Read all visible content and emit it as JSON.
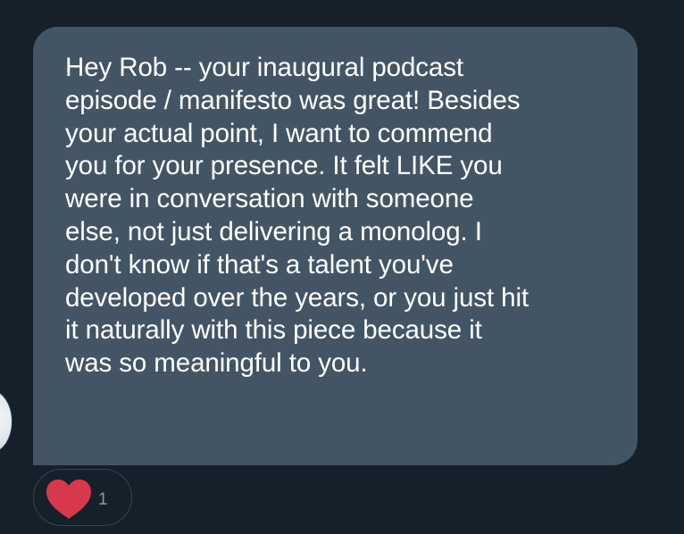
{
  "message": {
    "text": "Hey Rob -- your inaugural podcast\nepisode / manifesto was great! Besides\nyour actual point, I want to commend\nyou for your presence. It felt LIKE you\nwere in conversation with someone\nelse, not just delivering a monolog. I\ndon't know if that's a talent you've\ndeveloped over the years, or you just hit\nit naturally with this piece because it\nwas so meaningful to you."
  },
  "reaction": {
    "icon": "heart-icon",
    "count": "1",
    "color": "#e0245e"
  },
  "colors": {
    "background": "#15202b",
    "bubble": "#435565",
    "text": "#ffffff"
  }
}
